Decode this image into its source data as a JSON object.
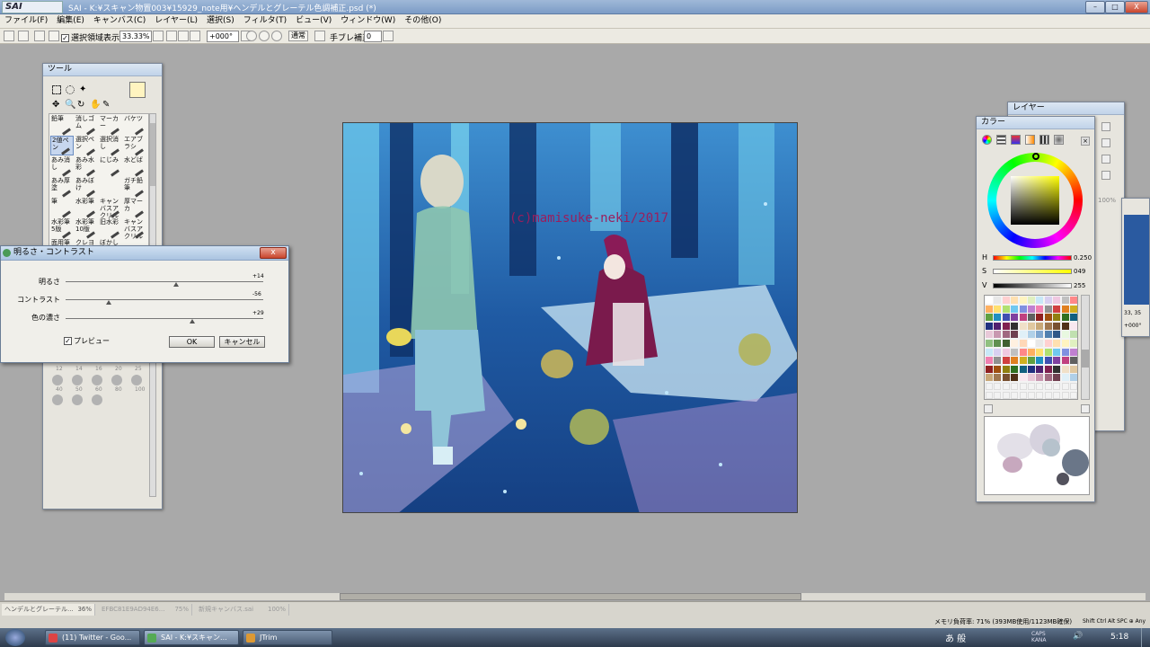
{
  "app": {
    "logo": "SAI",
    "title": "SAI - K:¥スキャン物置003¥15929_note用¥ヘンデルとグレーテル色調補正.psd (*)",
    "minimize": "–",
    "maximize": "□",
    "close": "X"
  },
  "menu": [
    "ファイル(F)",
    "編集(E)",
    "キャンバス(C)",
    "レイヤー(L)",
    "選択(S)",
    "フィルタ(T)",
    "ビュー(V)",
    "ウィンドウ(W)",
    "その他(O)"
  ],
  "toolbar": {
    "selection_show_label": "選択領域表示",
    "zoom": "33.33%",
    "angle": "+000°",
    "blend_mode": "通常",
    "stabilizer_label": "手ブレ補正",
    "stabilizer_value": "0"
  },
  "tool_panel": {
    "title": "ツール",
    "tools": [
      "鉛筆",
      "消しゴム",
      "マーカー",
      "バケツ",
      "2値ペン",
      "選択ペン",
      "選択消し",
      "エアブラシ",
      "あみ消し",
      "あみ水彩",
      "にじみ",
      "水どば",
      "あみ厚塗",
      "あみぼけ",
      "",
      "ガチ鉛筆",
      "筆",
      "水彩筆",
      "キャンバスアクリル",
      "厚マーカ",
      "水彩筆5版",
      "水彩筆10版",
      "旧水彩",
      "キャンバスアクリル",
      "面用筆アクリル",
      "クレヨン",
      "ぼかし",
      ""
    ],
    "size_labels": [
      "12",
      "14",
      "16",
      "20",
      "25",
      "40",
      "50",
      "60",
      "80",
      "100"
    ]
  },
  "dialog": {
    "title": "明るさ・コントラスト",
    "close": "x",
    "sliders": [
      {
        "label": "明るさ",
        "value": "+14",
        "level": 0.56
      },
      {
        "label": "コントラスト",
        "value": "-56",
        "level": 0.22
      },
      {
        "label": "色の濃さ",
        "value": "+29",
        "level": 0.64
      }
    ],
    "preview_label": "プレビュー",
    "ok_label": "OK",
    "cancel_label": "キャンセル"
  },
  "canvas": {
    "signature": "(c)mamisuke-neki/2017",
    "colors": {
      "bg": "#1c4f93",
      "deep": "#0e2f66",
      "cyan": "#6fd3ee",
      "hood": "#8a1b57",
      "yellow": "#e8d75a"
    }
  },
  "layer_panel": {
    "title": "レイヤー",
    "zoom_value": "100%",
    "readout": "33, 35",
    "angle_value": "+000°"
  },
  "color_panel": {
    "title": "カラー",
    "h_label": "H",
    "h_value": "0.250",
    "s_label": "S",
    "s_value": "049",
    "v_label": "V",
    "v_value": "255",
    "current_color": "#fff4c0",
    "sub_color": "#ffffff"
  },
  "doc_tabs": [
    {
      "name": "ヘンデルとグレーテル...",
      "zoom": "36%"
    },
    {
      "name": "EFBC81E9AD94E6...",
      "zoom": "75%"
    },
    {
      "name": "新規キャンバス.sai",
      "zoom": "100%"
    }
  ],
  "status": {
    "memory": "メモリ負荷率: 71% (393MB使用/1123MB確保)",
    "keys": "Shift Ctrl Alt SPC ⊕ Any"
  },
  "taskbar": {
    "items": [
      "(11) Twitter - Goo...",
      "SAI - K:¥スキャン...",
      "JTrim"
    ],
    "ime": "あ 般",
    "caps": "CAPS KANA",
    "clock": "5:18"
  }
}
